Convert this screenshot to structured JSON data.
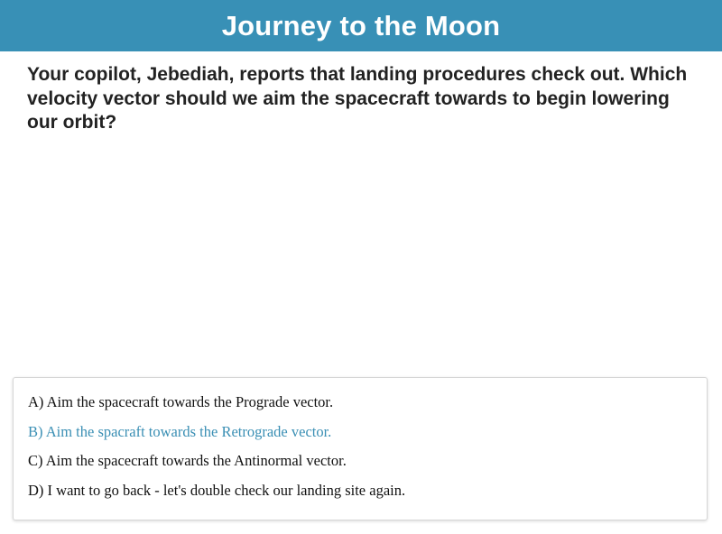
{
  "header": {
    "title": "Journey to the Moon"
  },
  "question": {
    "text": "Your copilot, Jebediah, reports that landing procedures check out. Which velocity vector should we aim the spacecraft towards to begin lowering our orbit?"
  },
  "choices": [
    {
      "label": "A) Aim the spacecraft towards the Prograde vector.",
      "highlighted": false
    },
    {
      "label": "B) Aim the spacraft towards the Retrograde vector.",
      "highlighted": true
    },
    {
      "label": "C) Aim the spacecraft towards the Antinormal vector.",
      "highlighted": false
    },
    {
      "label": "D) I want to go back - let's double check our landing site again.",
      "highlighted": false
    }
  ],
  "colors": {
    "header_background": "#3890b6",
    "header_text": "#ffffff",
    "highlight_text": "#3a8fb4",
    "body_text": "#222222"
  }
}
